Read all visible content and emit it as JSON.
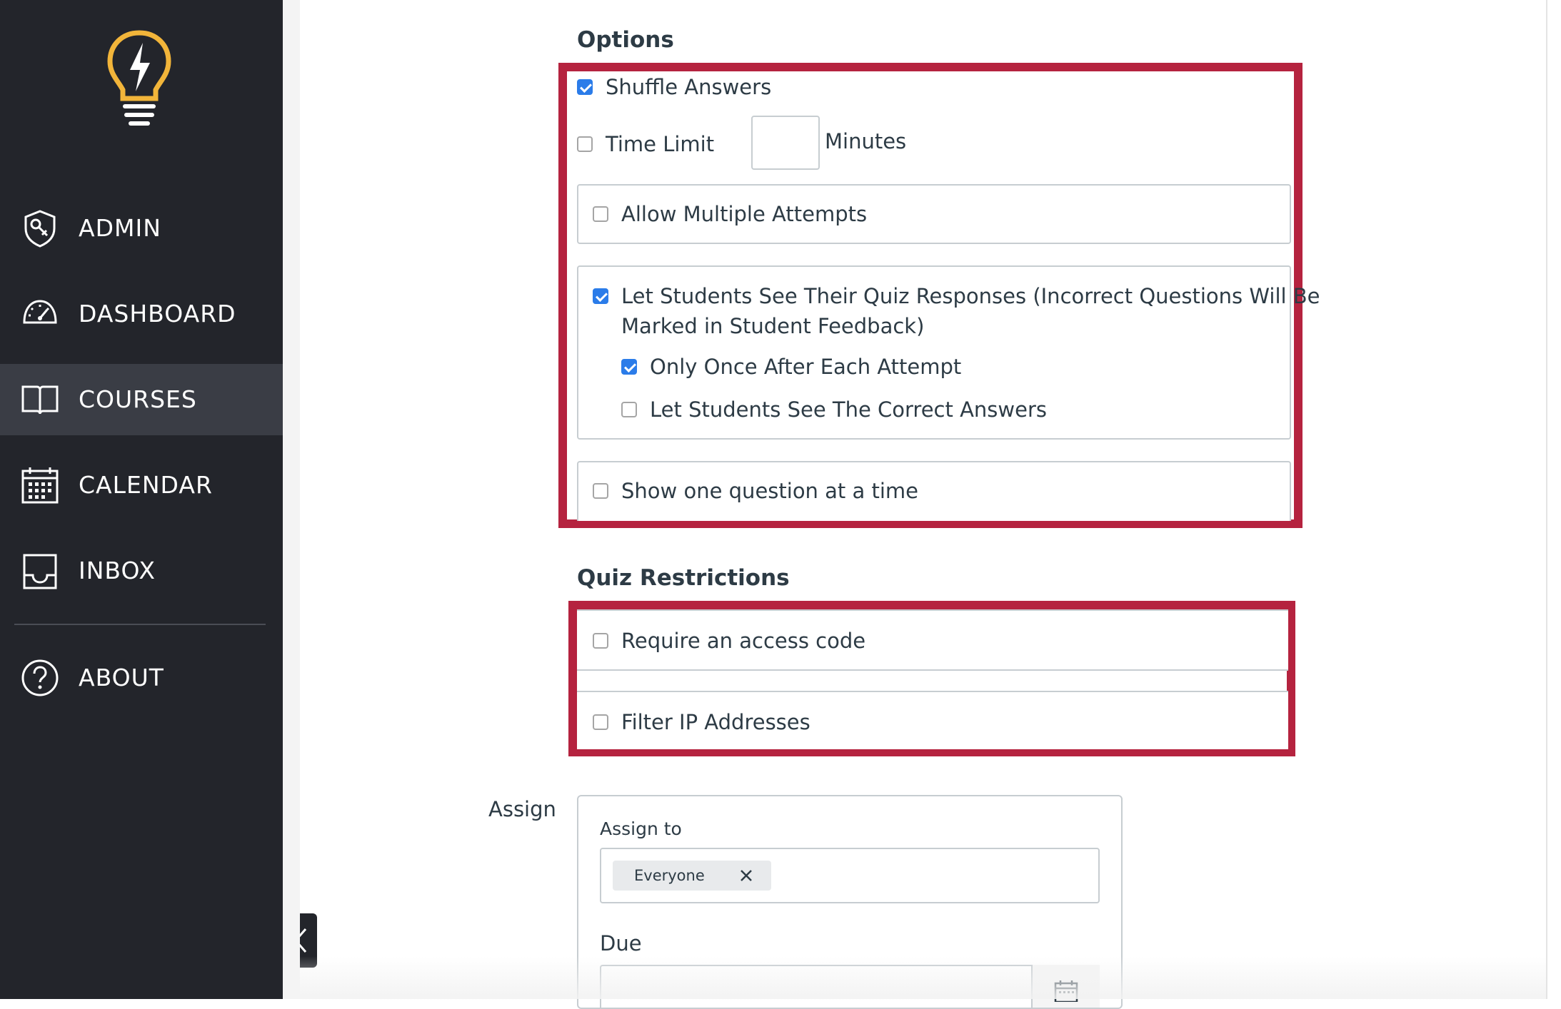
{
  "sidebar": {
    "items": [
      {
        "label": "ADMIN",
        "icon": "admin-shield-icon"
      },
      {
        "label": "DASHBOARD",
        "icon": "dashboard-gauge-icon"
      },
      {
        "label": "COURSES",
        "icon": "courses-book-icon",
        "active": true
      },
      {
        "label": "CALENDAR",
        "icon": "calendar-icon"
      },
      {
        "label": "INBOX",
        "icon": "inbox-tray-icon"
      },
      {
        "label": "ABOUT",
        "icon": "about-question-icon"
      }
    ],
    "logo_icon": "lightbulb-logo-icon",
    "collapse_icon": "chevron-left-icon"
  },
  "options": {
    "heading": "Options",
    "shuffle_answers": {
      "label": "Shuffle Answers",
      "checked": true
    },
    "time_limit": {
      "label": "Time Limit",
      "checked": false,
      "value": "",
      "unit": "Minutes"
    },
    "multiple_attempts": {
      "label": "Allow Multiple Attempts",
      "checked": false
    },
    "see_responses": {
      "label_line1": "Let Students See Their Quiz Responses (Incorrect Questions Will Be",
      "label_line2": "Marked in Student Feedback)",
      "checked": true,
      "once_after_attempt": {
        "label": "Only Once After Each Attempt",
        "checked": true
      },
      "see_correct": {
        "label": "Let Students See The Correct Answers",
        "checked": false
      }
    },
    "one_question": {
      "label": "Show one question at a time",
      "checked": false
    }
  },
  "restrictions": {
    "heading": "Quiz Restrictions",
    "access_code": {
      "label": "Require an access code",
      "checked": false
    },
    "filter_ip": {
      "label": "Filter IP Addresses",
      "checked": false
    }
  },
  "assign": {
    "label": "Assign",
    "assign_to_label": "Assign to",
    "assignee_tag": "Everyone",
    "due_label": "Due"
  },
  "colors": {
    "sidebar_bg": "#23252b",
    "sidebar_active": "#3a3d45",
    "highlight_border": "#b5233f",
    "checkbox_checked": "#2b7ce9",
    "logo_yellow": "#f2b53a"
  }
}
